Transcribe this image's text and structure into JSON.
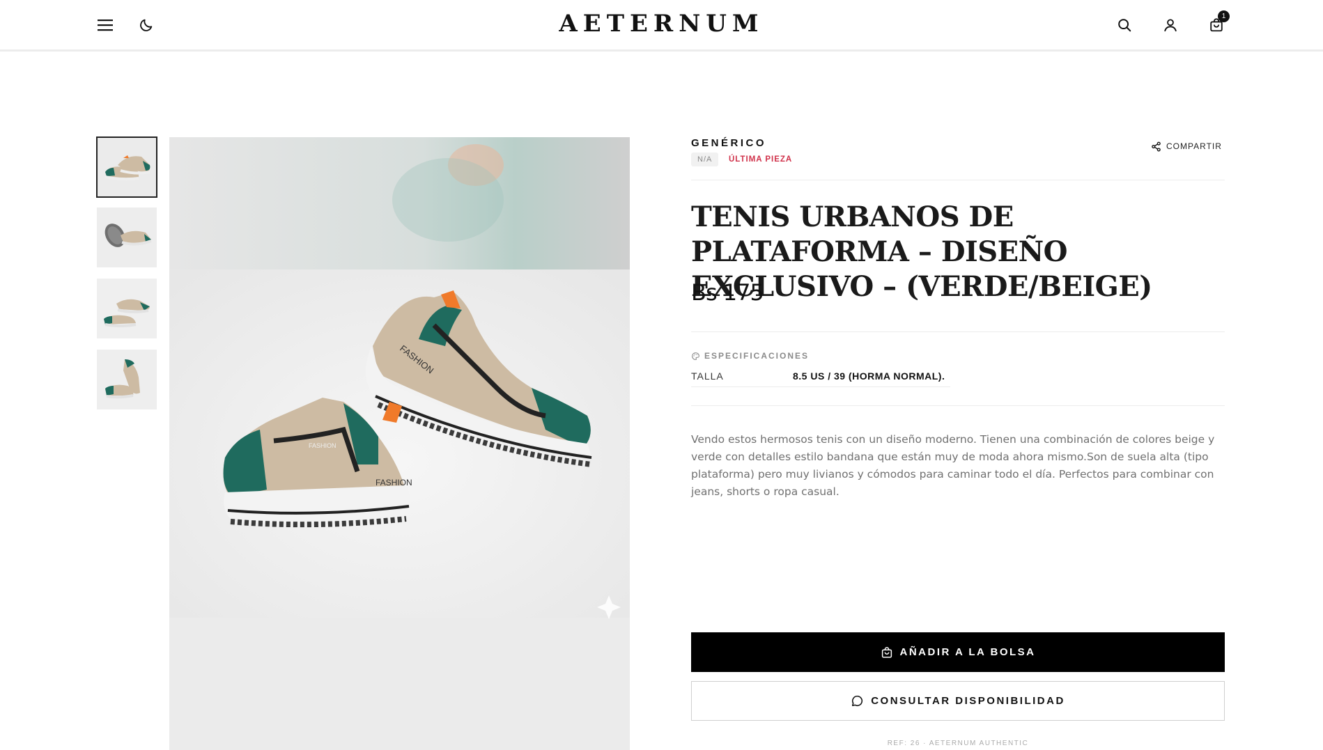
{
  "header": {
    "logo": "AETERNUM",
    "cart_count": "1",
    "icons": [
      "menu-icon",
      "moon-icon",
      "search-icon",
      "user-icon",
      "shopping-bag-icon"
    ]
  },
  "gallery": {
    "thumbnail_count": 4,
    "active_thumbnail": 0
  },
  "product": {
    "brand": "GENÉRICO",
    "condition_tag": "N/A",
    "stock_tag": "ÚLTIMA PIEZA",
    "share_label": "COMPARTIR",
    "title": "TENIS URBANOS DE PLATAFORMA – DISEÑO EXCLUSIVO – (VERDE/BEIGE)",
    "price": "Bs 175",
    "specs_heading": "ESPECIFICACIONES",
    "specs": [
      {
        "label": "TALLA",
        "value": "8.5 US / 39 (HORMA NORMAL)."
      }
    ],
    "description": "Vendo estos hermosos tenis con un diseño moderno. Tienen una combinación de colores beige y verde con detalles estilo bandana que están muy de moda ahora mismo.Son de suela alta (tipo plataforma) pero muy livianos y cómodos para caminar todo el día. Perfectos para combinar con jeans, shorts o ropa casual.",
    "add_to_bag_label": "AÑADIR A LA BOLSA",
    "ask_availability_label": "CONSULTAR DISPONIBILIDAD",
    "reference": "REF: 26 · AETERNUM AUTHENTIC"
  },
  "colors": {
    "accent_red": "#d0314a",
    "primary_black": "#000000",
    "shoe_green": "#1f6b5e",
    "shoe_beige": "#cdbba3",
    "shoe_orange": "#f07a2a"
  }
}
